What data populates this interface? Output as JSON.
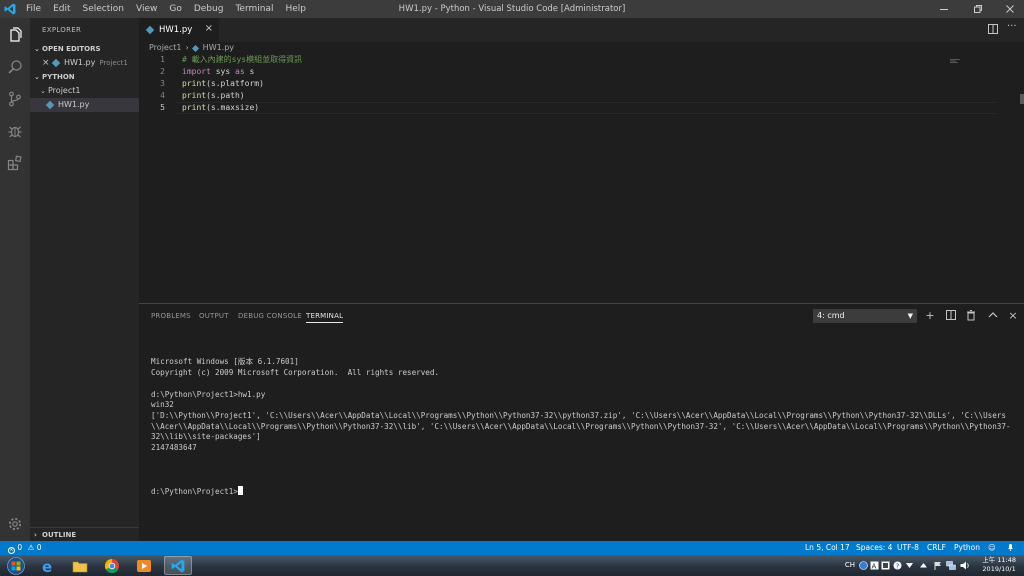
{
  "window": {
    "title": "HW1.py - Python - Visual Studio Code [Administrator]",
    "menu": [
      "File",
      "Edit",
      "Selection",
      "View",
      "Go",
      "Debug",
      "Terminal",
      "Help"
    ]
  },
  "sidebar": {
    "header": "EXPLORER",
    "open_editors_title": "OPEN EDITORS",
    "open_editors": [
      {
        "name": "HW1.py",
        "folder": "Project1"
      }
    ],
    "workspace_title": "PYTHON",
    "tree": [
      {
        "label": "Project1",
        "type": "folder"
      },
      {
        "label": "HW1.py",
        "type": "file",
        "selected": true
      }
    ],
    "outline_title": "OUTLINE"
  },
  "editor": {
    "tab_label": "HW1.py",
    "breadcrumb": [
      "Project1",
      "HW1.py"
    ],
    "lines": [
      {
        "num": "1",
        "tokens": [
          {
            "t": "# 載入內建的sys模組並取得資訊",
            "c": "comment"
          }
        ]
      },
      {
        "num": "2",
        "tokens": [
          {
            "t": "import",
            "c": "kw"
          },
          {
            "t": " sys ",
            "c": "plain"
          },
          {
            "t": "as",
            "c": "kw"
          },
          {
            "t": " s",
            "c": "plain"
          }
        ]
      },
      {
        "num": "3",
        "tokens": [
          {
            "t": "print",
            "c": "fn"
          },
          {
            "t": "(s.platform)",
            "c": "plain"
          }
        ]
      },
      {
        "num": "4",
        "tokens": [
          {
            "t": "print",
            "c": "fn"
          },
          {
            "t": "(s.path)",
            "c": "plain"
          }
        ]
      },
      {
        "num": "5",
        "tokens": [
          {
            "t": "print",
            "c": "fn"
          },
          {
            "t": "(s.maxsize)",
            "c": "plain"
          }
        ]
      }
    ]
  },
  "panel": {
    "tabs": [
      "PROBLEMS",
      "OUTPUT",
      "DEBUG CONSOLE",
      "TERMINAL"
    ],
    "active_tab": "TERMINAL",
    "terminal_select": "4: cmd",
    "terminal_lines": [
      "Microsoft Windows [版本 6.1.7601]",
      "Copyright (c) 2009 Microsoft Corporation.  All rights reserved.",
      "",
      "d:\\Python\\Project1>hw1.py",
      "win32",
      "['D:\\\\Python\\\\Project1', 'C:\\\\Users\\\\Acer\\\\AppData\\\\Local\\\\Programs\\\\Python\\\\Python37-32\\\\python37.zip', 'C:\\\\Users\\\\Acer\\\\AppData\\\\Local\\\\Programs\\\\Python\\\\Python37-32\\\\DLLs', 'C:\\\\Users\\\\Acer\\\\AppData\\\\Local\\\\Programs\\\\Python\\\\Python37-32\\\\lib', 'C:\\\\Users\\\\Acer\\\\AppData\\\\Local\\\\Programs\\\\Python\\\\Python37-32', 'C:\\\\Users\\\\Acer\\\\AppData\\\\Local\\\\Programs\\\\Python\\\\Python37-32\\\\lib\\\\site-packages']",
      "2147483647",
      ""
    ],
    "prompt": "d:\\Python\\Project1>"
  },
  "statusbar": {
    "errors": "0",
    "warnings": "0",
    "position": "Ln 5, Col 17",
    "spaces": "Spaces: 4",
    "encoding": "UTF-8",
    "eol": "CRLF",
    "language": "Python"
  },
  "taskbar": {
    "tray_lang": "CH",
    "time": "上午 11:48",
    "date": "2019/10/1"
  },
  "colors": {
    "statusbar": "#007acc",
    "activitybar": "#333333",
    "sidebar": "#252526",
    "editor": "#1e1e1e"
  }
}
